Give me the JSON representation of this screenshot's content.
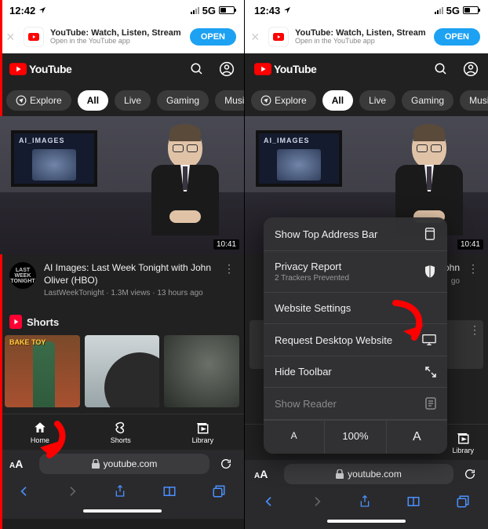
{
  "left": {
    "status": {
      "time": "12:42",
      "net": "5G"
    },
    "banner": {
      "title": "YouTube: Watch, Listen, Stream",
      "sub": "Open in the YouTube app",
      "open": "OPEN"
    },
    "header": {
      "brand": "YouTube"
    },
    "chips": {
      "explore": "Explore",
      "items": [
        "All",
        "Live",
        "Gaming",
        "Music"
      ]
    },
    "video": {
      "monitor_text": "AI_IMAGES",
      "duration": "10:41",
      "title": "AI Images: Last Week Tonight with John Oliver (HBO)",
      "channel_av": "LAST WEEK TONIGHT",
      "sub": "LastWeekTonight · 1.3M views · 13 hours ago"
    },
    "shorts": {
      "title": "Shorts",
      "label1": "BAKE TOY"
    },
    "nav": {
      "home": "Home",
      "shorts": "Shorts",
      "library": "Library"
    },
    "safari": {
      "aa": "AA",
      "url": "youtube.com"
    }
  },
  "right": {
    "status": {
      "time": "12:43",
      "net": "5G"
    },
    "banner": {
      "title": "YouTube: Watch, Listen, Stream",
      "sub": "Open in the YouTube app",
      "open": "OPEN"
    },
    "header": {
      "brand": "YouTube"
    },
    "chips": {
      "explore": "Explore",
      "items": [
        "All",
        "Live",
        "Gaming",
        "Music"
      ]
    },
    "video": {
      "monitor_text": "AI_IMAGES",
      "duration": "10:41",
      "title_tail": "ohn",
      "sub_tail": "go"
    },
    "nav": {
      "library": "Library"
    },
    "safari": {
      "aa": "AA",
      "url": "youtube.com"
    },
    "popup": {
      "row1": "Show Top Address Bar",
      "row2": "Privacy Report",
      "row2_sub": "2 Trackers Prevented",
      "row3": "Website Settings",
      "row4": "Request Desktop Website",
      "row5": "Hide Toolbar",
      "row6": "Show Reader",
      "zoom_small": "A",
      "zoom_pct": "100%",
      "zoom_big": "A"
    }
  }
}
